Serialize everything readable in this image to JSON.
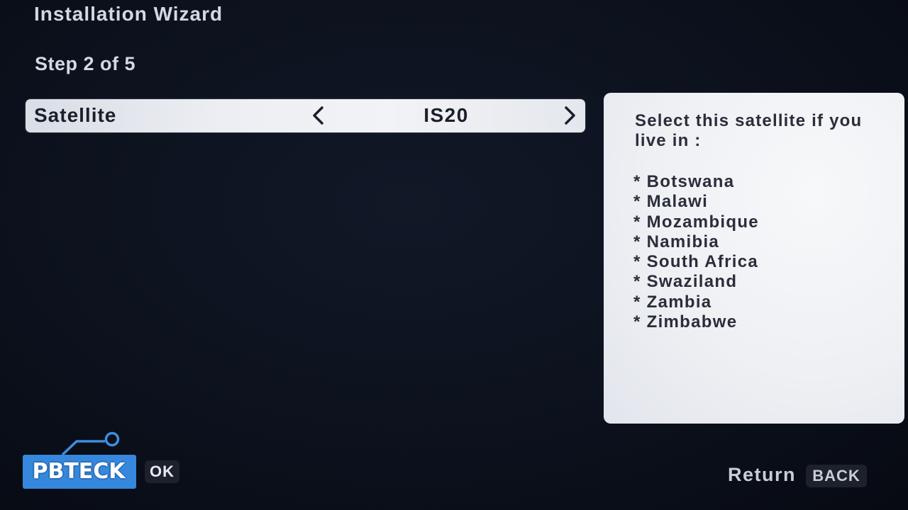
{
  "wizard": {
    "title": "Installation Wizard",
    "step": "Step 2 of 5"
  },
  "satellite_selector": {
    "label": "Satellite",
    "value": "IS20",
    "prev_icon": "chevron-left-icon",
    "next_icon": "chevron-right-icon"
  },
  "info_panel": {
    "text": "Select this satellite if you live in :",
    "countries": [
      "* Botswana",
      "* Malawi",
      "* Mozambique",
      "* Namibia",
      "* South Africa",
      "* Swaziland",
      "* Zambia",
      "* Zimbabwe"
    ]
  },
  "footer": {
    "logo_text": "PBTECK",
    "ok_key": "OK",
    "return_label": "Return",
    "back_key": "BACK"
  },
  "colors": {
    "background": "#0c111d",
    "selector_bar": "#eceef3",
    "panel": "#eef0f4",
    "logo_blue": "#2f80d6"
  }
}
